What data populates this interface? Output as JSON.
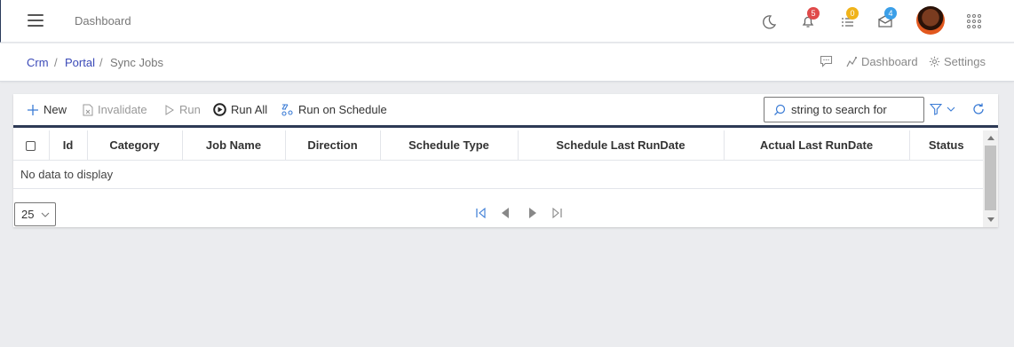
{
  "header": {
    "title": "Dashboard",
    "notifications_badge": "5",
    "tasks_badge": "0",
    "messages_badge": "4",
    "badge_colors": {
      "notifications": "#e04a4a",
      "tasks": "#f0b31a",
      "messages": "#3b9fe8"
    }
  },
  "breadcrumb": {
    "items": [
      "Crm",
      "Portal",
      "Sync Jobs"
    ],
    "separator": "/",
    "actions": {
      "dashboard": "Dashboard",
      "settings": "Settings"
    }
  },
  "toolbar": {
    "new": "New",
    "invalidate": "Invalidate",
    "run": "Run",
    "run_all": "Run All",
    "run_on_schedule": "Run on Schedule",
    "search_placeholder": "string to search for"
  },
  "table": {
    "columns": [
      "Id",
      "Category",
      "Job Name",
      "Direction",
      "Schedule Type",
      "Schedule Last RunDate",
      "Actual Last RunDate",
      "Status"
    ],
    "empty_text": "No data to display"
  },
  "pager": {
    "page_size": "25"
  },
  "colors": {
    "accent": "#3b4ab8",
    "toolbar_border": "#2d3a55",
    "icon_blue": "#3a7bd5"
  }
}
